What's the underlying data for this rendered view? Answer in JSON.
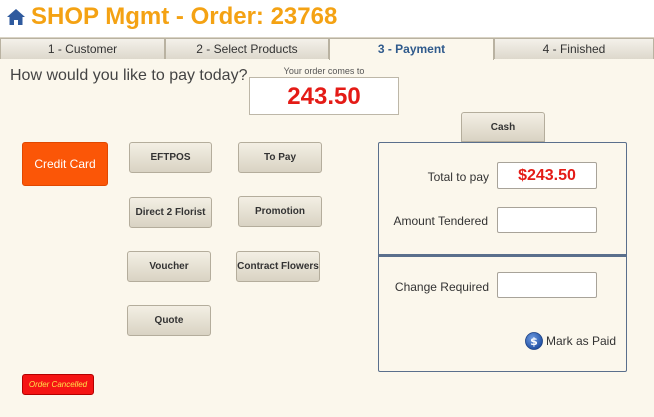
{
  "header": {
    "title": "SHOP Mgmt - Order: 23768",
    "home_icon": "home-icon",
    "title_color": "#f4a213"
  },
  "tabs": [
    {
      "label": "1 - Customer",
      "active": false
    },
    {
      "label": "2 - Select Products",
      "active": false
    },
    {
      "label": "3 - Payment",
      "active": true
    },
    {
      "label": "4 - Finished",
      "active": false
    }
  ],
  "payment": {
    "question": "How would you like to pay today?",
    "total_caption": "Your order comes to",
    "total_amount": "243.50",
    "methods": {
      "credit_card": "Credit Card",
      "eftpos": "EFTPOS",
      "to_pay": "To Pay",
      "direct_2_florist": "Direct 2 Florist",
      "promotion": "Promotion",
      "voucher": "Voucher",
      "contract_flowers": "Contract Flowers",
      "quote": "Quote",
      "cash": "Cash"
    },
    "order_cancelled": "Order Cancelled"
  },
  "cash_panel": {
    "total_label": "Total to pay",
    "total_value": "$243.50",
    "tendered_label": "Amount Tendered",
    "tendered_value": "",
    "change_label": "Change Required",
    "change_value": "",
    "mark_paid_label": "Mark as Paid",
    "mark_paid_icon": "dollar-icon"
  },
  "colors": {
    "accent_orange": "#fb5607",
    "total_red": "#e41b16",
    "panel_border": "#5a6f8c",
    "active_tab_text": "#2f5a8c",
    "cancelled_bg": "#f51414"
  }
}
